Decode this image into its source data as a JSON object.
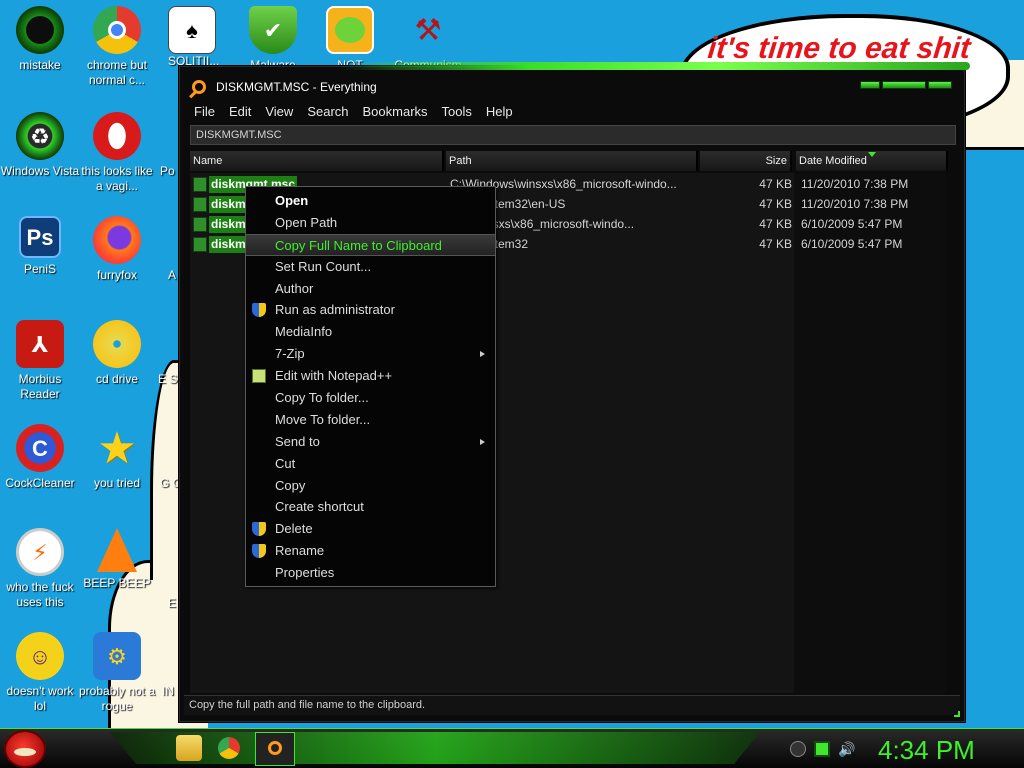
{
  "desktop": {
    "speech_bubble": "it's time to eat shit",
    "icons": [
      {
        "label": "mistake",
        "icon": "green-circle-icon"
      },
      {
        "label": "chrome but normal c...",
        "icon": "chrome-icon"
      },
      {
        "label": "SOLITII...",
        "icon": "cards-icon"
      },
      {
        "label": "Malware",
        "icon": "shield-icon"
      },
      {
        "label": "NOT",
        "icon": "angry-birds-pig-icon"
      },
      {
        "label": "Communism",
        "icon": "communism-icon"
      },
      {
        "label": "Windows Vista",
        "icon": "recycle-bin-icon"
      },
      {
        "label": "this looks like a vagi...",
        "icon": "opera-icon"
      },
      {
        "label": "Po",
        "icon": "partial-icon"
      },
      {
        "label": "PeniS",
        "icon": "photoshop-icon"
      },
      {
        "label": "furryfox",
        "icon": "firefox-icon"
      },
      {
        "label": "A",
        "icon": "partial-icon"
      },
      {
        "label": "Morbius Reader",
        "icon": "pdf-reader-icon"
      },
      {
        "label": "cd drive",
        "icon": "cd-icon"
      },
      {
        "label": "E SIM",
        "icon": "partial-icon"
      },
      {
        "label": "CockCleaner",
        "icon": "ccleaner-icon"
      },
      {
        "label": "you tried",
        "icon": "star-icon"
      },
      {
        "label": "G GA",
        "icon": "partial-icon"
      },
      {
        "label": "who the fuck uses this",
        "icon": "lightning-icon"
      },
      {
        "label": "BEEP BEEP",
        "icon": "vlc-cone-icon"
      },
      {
        "label": "E",
        "icon": "partial-icon"
      },
      {
        "label": "doesn't work lol",
        "icon": "yahoo-messenger-icon"
      },
      {
        "label": "probably not a rogue",
        "icon": "settings-gears-icon"
      },
      {
        "label": "IN",
        "icon": "partial-icon"
      }
    ]
  },
  "window": {
    "title": "DISKMGMT.MSC - Everything",
    "menu": [
      "File",
      "Edit",
      "View",
      "Search",
      "Bookmarks",
      "Tools",
      "Help"
    ],
    "search_value": "DISKMGMT.MSC",
    "columns": {
      "name": "Name",
      "path": "Path",
      "size": "Size",
      "date": "Date Modified"
    },
    "rows": [
      {
        "name": "diskmgmt.msc",
        "path": "C:\\Windows\\winsxs\\x86_microsoft-windo...",
        "size": "47 KB",
        "date": "11/20/2010 7:38 PM"
      },
      {
        "name": "diskm",
        "path": "ows\\System32\\en-US",
        "size": "47 KB",
        "date": "11/20/2010 7:38 PM"
      },
      {
        "name": "diskm",
        "path": "ows\\winsxs\\x86_microsoft-windo...",
        "size": "47 KB",
        "date": "6/10/2009 5:47 PM"
      },
      {
        "name": "diskm",
        "path": "ows\\System32",
        "size": "47 KB",
        "date": "6/10/2009 5:47 PM"
      }
    ],
    "status": "Copy the full path and file name to the clipboard."
  },
  "context_menu": {
    "items": [
      {
        "label": "Open"
      },
      {
        "label": "Open Path"
      },
      {
        "label": "Copy Full Name to Clipboard"
      },
      {
        "label": "Set Run Count..."
      },
      {
        "label": "Author"
      },
      {
        "label": "Run as administrator"
      },
      {
        "label": "MediaInfo"
      },
      {
        "label": "7-Zip"
      },
      {
        "label": "Edit with Notepad++"
      },
      {
        "label": "Copy To folder..."
      },
      {
        "label": "Move To folder..."
      },
      {
        "label": "Send to"
      },
      {
        "label": "Cut"
      },
      {
        "label": "Copy"
      },
      {
        "label": "Create shortcut"
      },
      {
        "label": "Delete"
      },
      {
        "label": "Rename"
      },
      {
        "label": "Properties"
      }
    ]
  },
  "taskbar": {
    "clock": "4:34 PM"
  }
}
